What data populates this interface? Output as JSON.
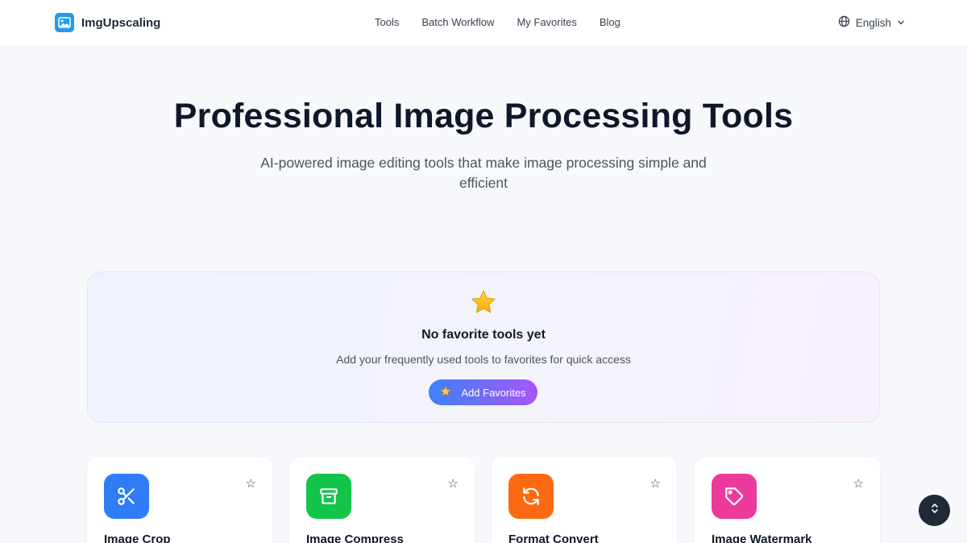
{
  "brand": {
    "name": "ImgUpscaling",
    "logo_icon": "image-icon",
    "color": "#1e9bf0"
  },
  "nav": {
    "items": [
      "Tools",
      "Batch Workflow",
      "My Favorites",
      "Blog"
    ]
  },
  "language": {
    "label": "English",
    "icon": "globe-icon"
  },
  "hero": {
    "title": "Professional Image Processing Tools",
    "subtitle": "AI-powered image editing tools that make image processing simple and efficient"
  },
  "favorites": {
    "title": "No favorite tools yet",
    "description": "Add your frequently used tools to favorites for quick access",
    "button_label": "Add Favorites",
    "gradient": [
      "#3b82f6",
      "#a855f7"
    ]
  },
  "tools": [
    {
      "name": "Image Crop",
      "icon": "scissors-icon",
      "color": "#2f7cf6"
    },
    {
      "name": "Image Compress",
      "icon": "archive-icon",
      "color": "#12c54a"
    },
    {
      "name": "Format Convert",
      "icon": "refresh-icon",
      "color": "#fb6a12"
    },
    {
      "name": "Image Watermark",
      "icon": "tag-icon",
      "color": "#ec3a9c"
    }
  ]
}
